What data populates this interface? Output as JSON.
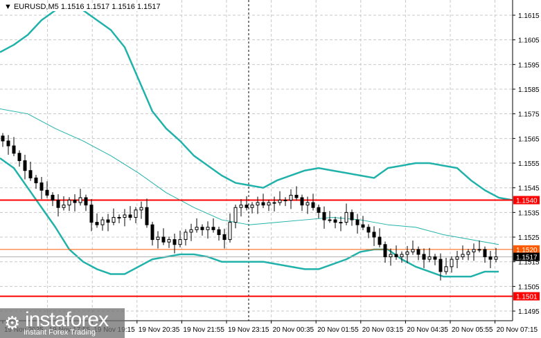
{
  "title": {
    "arrow": "▼",
    "symbol": "EURUSD,M5",
    "ohlc": "1.1516 1.1517 1.1516 1.1517"
  },
  "logo": {
    "name": "instaforex",
    "tagline": "Instant Forex Trading"
  },
  "chart_data": {
    "type": "candlestick",
    "symbol": "EURUSD",
    "timeframe": "M5",
    "ylim": [
      1.1495,
      1.1615
    ],
    "yticks": [
      "1.1615",
      "1.1605",
      "1.1595",
      "1.1585",
      "1.1575",
      "1.1565",
      "1.1555",
      "1.1545",
      "1.1535",
      "1.1525",
      "1.1515",
      "1.1505",
      "1.1495"
    ],
    "xticks": [
      "19 Nov 2025",
      "19 Nov 17:55",
      "19 Nov 19:15",
      "19 Nov 20:35",
      "19 Nov 21:55",
      "19 Nov 23:15",
      "20 Nov 00:35",
      "20 Nov 01:55",
      "20 Nov 03:15",
      "20 Nov 04:35",
      "20 Nov 05:55",
      "20 Nov 07:15"
    ],
    "close": [
      1.1564,
      1.1562,
      1.1559,
      1.1556,
      1.1552,
      1.1549,
      1.1547,
      1.1544,
      1.1542,
      1.154,
      1.1537,
      1.1538,
      1.154,
      1.1539,
      1.1541,
      1.1538,
      1.1531,
      1.153,
      1.1532,
      1.1531,
      1.1533,
      1.1533,
      1.1534,
      1.1533,
      1.1536,
      1.1537,
      1.153,
      1.1524,
      1.1525,
      1.1523,
      1.1524,
      1.1522,
      1.1524,
      1.1527,
      1.1528,
      1.1529,
      1.1528,
      1.1529,
      1.1528,
      1.1526,
      1.1524,
      1.1531,
      1.1537,
      1.1538,
      1.1537,
      1.1538,
      1.1539,
      1.1538,
      1.1539,
      1.1539,
      1.154,
      1.154,
      1.1542,
      1.1541,
      1.1538,
      1.1539,
      1.1537,
      1.1535,
      1.1532,
      1.1532,
      1.1531,
      1.1531,
      1.1535,
      1.1532,
      1.153,
      1.1529,
      1.1527,
      1.1525,
      1.1522,
      1.1517,
      1.1518,
      1.1517,
      1.1518,
      1.1519,
      1.152,
      1.1518,
      1.1516,
      1.1517,
      1.1516,
      1.1511,
      1.1513,
      1.1516,
      1.1517,
      1.1518,
      1.1519,
      1.152,
      1.152,
      1.1517,
      1.1516,
      1.1517
    ],
    "bollinger": {
      "upper": [
        1.16,
        1.1603,
        1.1607,
        1.1613,
        1.1617,
        1.1619,
        1.1617,
        1.1613,
        1.1609,
        1.1602,
        1.1589,
        1.1576,
        1.1569,
        1.1564,
        1.1558,
        1.1554,
        1.155,
        1.1547,
        1.1546,
        1.1545,
        1.1548,
        1.155,
        1.1552,
        1.1553,
        1.1552,
        1.1551,
        1.155,
        1.1549,
        1.1553,
        1.1554,
        1.1555,
        1.1555,
        1.1554,
        1.1553,
        1.1548,
        1.1544,
        1.1541,
        1.154
      ],
      "middle": [
        1.1577,
        1.1575,
        1.1569,
        1.1564,
        1.1558,
        1.1551,
        1.1543,
        1.1537,
        1.1532,
        1.153,
        1.1531,
        1.1532,
        1.1533,
        1.1532,
        1.153,
        1.1529,
        1.1526,
        1.1524,
        1.1522
      ],
      "lower": [
        1.1557,
        1.1553,
        1.1545,
        1.1537,
        1.1529,
        1.152,
        1.1515,
        1.1512,
        1.151,
        1.151,
        1.1513,
        1.1516,
        1.1517,
        1.1518,
        1.1518,
        1.1517,
        1.1515,
        1.1515,
        1.1515,
        1.1515,
        1.1514,
        1.1513,
        1.1512,
        1.1512,
        1.1514,
        1.1516,
        1.1519,
        1.152,
        1.152,
        1.1516,
        1.1513,
        1.1511,
        1.1509,
        1.1509,
        1.1509,
        1.1511,
        1.1511
      ]
    },
    "levels": [
      {
        "price": "1.1540",
        "color": "#ff0000"
      },
      {
        "price": "1.1520",
        "color": "#ff5a00"
      },
      {
        "price": "1.1501",
        "color": "#ff0000"
      }
    ],
    "bid": {
      "price": "1.1517",
      "color": "#000000"
    },
    "band_color": "#20b2aa"
  }
}
